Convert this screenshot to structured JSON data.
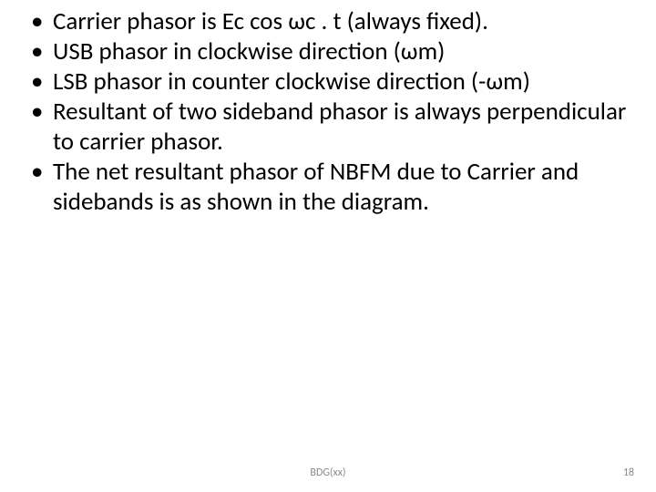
{
  "bullets": [
    "Carrier phasor is Ec cos ωc . t (always fixed).",
    "USB phasor in clockwise direction (ωm)",
    "LSB phasor in counter clockwise direction (-ωm)",
    "Resultant of two sideband phasor  is always perpendicular to carrier phasor.",
    "The net resultant phasor of NBFM due to Carrier and sidebands is as shown in the diagram."
  ],
  "footer": {
    "center": "BDG(xx)",
    "page": "18"
  }
}
